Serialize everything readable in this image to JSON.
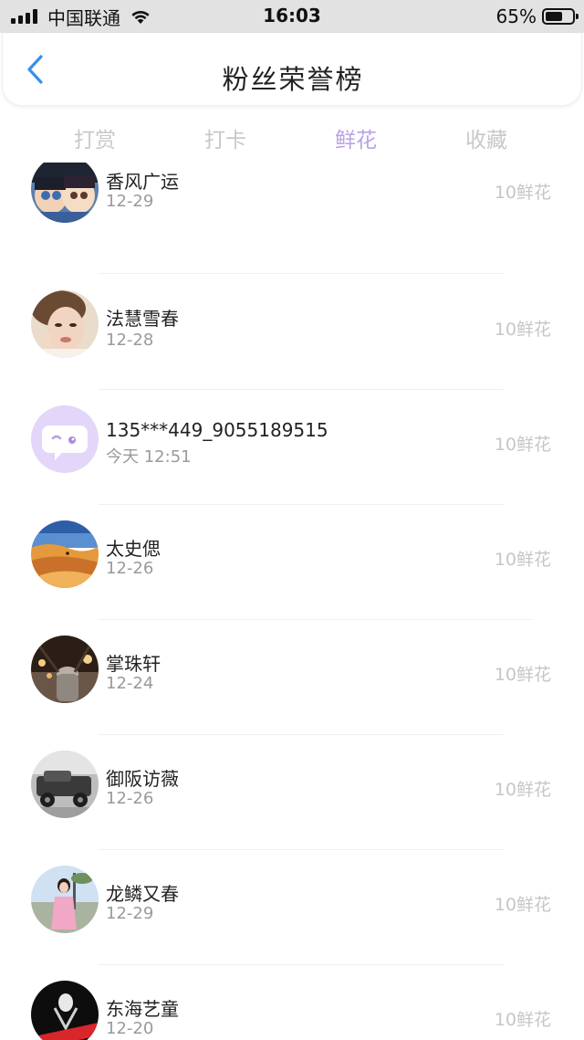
{
  "status_bar": {
    "carrier": "中国联通",
    "time": "16:03",
    "battery": "65%",
    "battery_level": 0.65
  },
  "header": {
    "title": "粉丝荣誉榜",
    "back_icon": "chevron-left-icon"
  },
  "tabs": [
    {
      "label": "打赏",
      "active": false
    },
    {
      "label": "打卡",
      "active": false
    },
    {
      "label": "鲜花",
      "active": true
    },
    {
      "label": "收藏",
      "active": false
    }
  ],
  "colors": {
    "accent": "#b9a2e6",
    "back_icon": "#3a8ee6"
  },
  "list": [
    {
      "name": "香风广运",
      "date": "12-29",
      "amount": "10鲜花",
      "avatar": "anime-avatar"
    },
    {
      "name": "法慧雪春",
      "date": "12-28",
      "amount": "10鲜花",
      "avatar": "portrait-avatar"
    },
    {
      "name": "135***449_9055189515",
      "date": "今天 12:51",
      "amount": "10鲜花",
      "avatar": "chat-bubble-avatar"
    },
    {
      "name": "太史偲",
      "date": "12-26",
      "amount": "10鲜花",
      "avatar": "desert-avatar"
    },
    {
      "name": "掌珠轩",
      "date": "12-24",
      "amount": "10鲜花",
      "avatar": "street-avatar"
    },
    {
      "name": "御阪访薇",
      "date": "12-26",
      "amount": "10鲜花",
      "avatar": "vintage-car-avatar"
    },
    {
      "name": "龙鳞又春",
      "date": "12-29",
      "amount": "10鲜花",
      "avatar": "girl-avatar"
    },
    {
      "name": "东海艺童",
      "date": "12-20",
      "amount": "10鲜花",
      "avatar": "poster-avatar"
    }
  ]
}
